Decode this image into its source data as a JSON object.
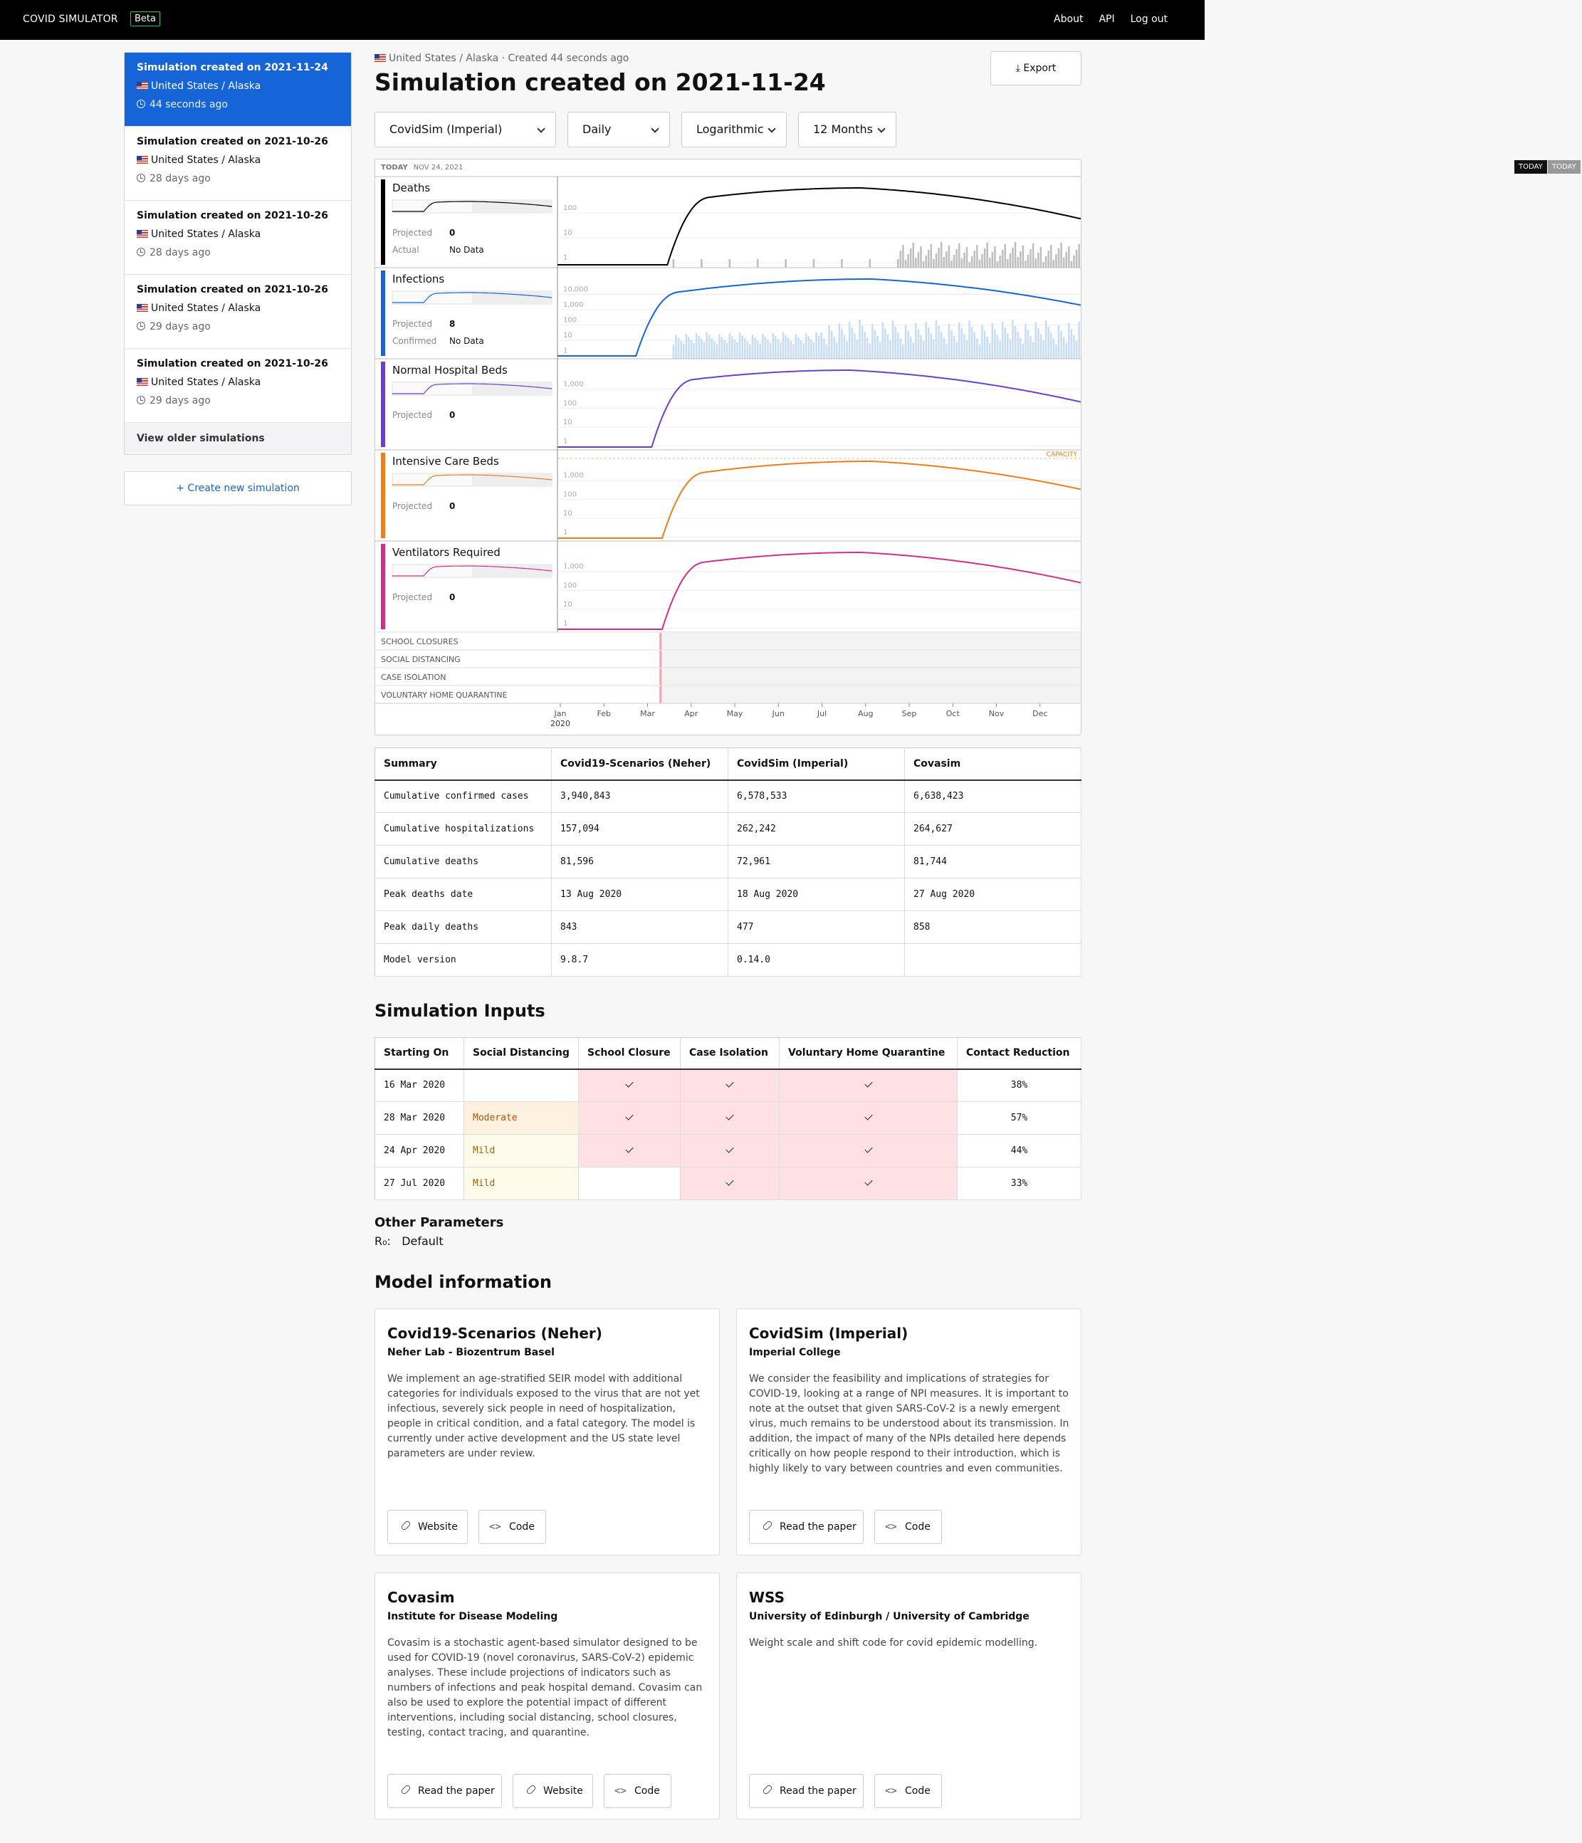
{
  "nav": {
    "brand": "COVID SIMULATOR",
    "beta": "Beta",
    "links": [
      "About",
      "API",
      "Log out"
    ]
  },
  "sidebar": {
    "items": [
      {
        "title": "Simulation created on 2021-11-24",
        "location": "United States / Alaska",
        "time": "44 seconds ago"
      },
      {
        "title": "Simulation created on 2021-10-26",
        "location": "United States / Alaska",
        "time": "28 days ago"
      },
      {
        "title": "Simulation created on 2021-10-26",
        "location": "United States / Alaska",
        "time": "28 days ago"
      },
      {
        "title": "Simulation created on 2021-10-26",
        "location": "United States / Alaska",
        "time": "29 days ago"
      },
      {
        "title": "Simulation created on 2021-10-26",
        "location": "United States / Alaska",
        "time": "29 days ago"
      }
    ],
    "older": "View older simulations",
    "create": "+ Create new simulation"
  },
  "header": {
    "breadcrumb": "United States / Alaska · Created 44 seconds ago",
    "title": "Simulation created on 2021-11-24",
    "export": "Export"
  },
  "controls": {
    "model": "CovidSim (Imperial)",
    "interval": "Daily",
    "scale": "Logarithmic",
    "range": "12 Months"
  },
  "chart": {
    "today_label": "TODAY",
    "today_date": "NOV 24, 2021",
    "capacity_label": "CAPACITY",
    "rows": [
      {
        "name": "Deaths",
        "color": "#000000",
        "metrics": [
          {
            "label": "Projected",
            "value": "0"
          },
          {
            "label": "Actual",
            "value": "No Data"
          }
        ],
        "ticks": [
          "100",
          "10",
          "1"
        ]
      },
      {
        "name": "Infections",
        "color": "#1565d8",
        "metrics": [
          {
            "label": "Projected",
            "value": "8"
          },
          {
            "label": "Confirmed",
            "value": "No Data"
          }
        ],
        "ticks": [
          "10,000",
          "1,000",
          "100",
          "10",
          "1"
        ]
      },
      {
        "name": "Normal Hospital Beds",
        "color": "#6b3fcf",
        "metrics": [
          {
            "label": "Projected",
            "value": "0"
          }
        ],
        "ticks": [
          "1,000",
          "100",
          "10",
          "1"
        ]
      },
      {
        "name": "Intensive Care Beds",
        "color": "#f07c1a",
        "metrics": [
          {
            "label": "Projected",
            "value": "0"
          }
        ],
        "ticks": [
          "1,000",
          "100",
          "10",
          "1"
        ]
      },
      {
        "name": "Ventilators Required",
        "color": "#d22e8c",
        "metrics": [
          {
            "label": "Projected",
            "value": "0"
          }
        ],
        "ticks": [
          "1,000",
          "100",
          "10",
          "1"
        ]
      }
    ],
    "interventions": [
      "SCHOOL CLOSURES",
      "SOCIAL DISTANCING",
      "CASE ISOLATION",
      "VOLUNTARY HOME QUARANTINE"
    ],
    "months": [
      "Jan",
      "Feb",
      "Mar",
      "Apr",
      "May",
      "Jun",
      "Jul",
      "Aug",
      "Sep",
      "Oct",
      "Nov",
      "Dec"
    ],
    "year": "2020"
  },
  "right_tags": {
    "a": "TODAY",
    "b": "TODAY"
  },
  "summary": {
    "headers": [
      "Summary",
      "Covid19-Scenarios (Neher)",
      "CovidSim (Imperial)",
      "Covasim"
    ],
    "rows": [
      [
        "Cumulative confirmed cases",
        "3,940,843",
        "6,578,533",
        "6,638,423"
      ],
      [
        "Cumulative hospitalizations",
        "157,094",
        "262,242",
        "264,627"
      ],
      [
        "Cumulative deaths",
        "81,596",
        "72,961",
        "81,744"
      ],
      [
        "Peak deaths date",
        "13 Aug 2020",
        "18 Aug 2020",
        "27 Aug 2020"
      ],
      [
        "Peak daily deaths",
        "843",
        "477",
        "858"
      ],
      [
        "Model version",
        "9.8.7",
        "0.14.0",
        ""
      ]
    ]
  },
  "inputs": {
    "title": "Simulation Inputs",
    "headers": [
      "Starting On",
      "Social Distancing",
      "School Closure",
      "Case Isolation",
      "Voluntary Home Quarantine",
      "Contact Reduction"
    ],
    "rows": [
      {
        "date": "16 Mar 2020",
        "sd": "",
        "school": true,
        "isolation": true,
        "quarantine": true,
        "reduction": "38%"
      },
      {
        "date": "28 Mar 2020",
        "sd": "Moderate",
        "school": true,
        "isolation": true,
        "quarantine": true,
        "reduction": "57%"
      },
      {
        "date": "24 Apr 2020",
        "sd": "Mild",
        "school": true,
        "isolation": true,
        "quarantine": true,
        "reduction": "44%"
      },
      {
        "date": "27 Jul 2020",
        "sd": "Mild",
        "school": false,
        "isolation": true,
        "quarantine": true,
        "reduction": "33%"
      }
    ]
  },
  "other": {
    "title": "Other Parameters",
    "r0_label": "R₀:",
    "r0_value": "Default"
  },
  "models": {
    "title": "Model information",
    "cards": [
      {
        "name": "Covid19-Scenarios (Neher)",
        "org": "Neher Lab - Biozentrum Basel",
        "desc": "We implement an age-stratified SEIR model with additional categories for individuals exposed to the virus that are not yet infectious, severely sick people in need of hospitalization, people in critical condition, and a fatal category. The model is currently under active development and the US state level parameters are under review.",
        "buttons": [
          "Website",
          "Code"
        ]
      },
      {
        "name": "CovidSim (Imperial)",
        "org": "Imperial College",
        "desc": "We consider the feasibility and implications of strategies for COVID-19, looking at a range of NPI measures. It is important to note at the outset that given SARS-CoV-2 is a newly emergent virus, much remains to be understood about its transmission. In addition, the impact of many of the NPIs detailed here depends critically on how people respond to their introduction, which is highly likely to vary between countries and even communities.",
        "buttons": [
          "Read the paper",
          "Code"
        ]
      },
      {
        "name": "Covasim",
        "org": "Institute for Disease Modeling",
        "desc": "Covasim is a stochastic agent-based simulator designed to be used for COVID-19 (novel coronavirus, SARS-CoV-2) epidemic analyses. These include projections of indicators such as numbers of infections and peak hospital demand. Covasim can also be used to explore the potential impact of different interventions, including social distancing, school closures, testing, contact tracing, and quarantine.",
        "buttons": [
          "Read the paper",
          "Website",
          "Code"
        ]
      },
      {
        "name": "WSS",
        "org": "University of Edinburgh / University of Cambridge",
        "desc": "Weight scale and shift code for covid epidemic modelling.",
        "buttons": [
          "Read the paper",
          "Code"
        ]
      }
    ]
  }
}
